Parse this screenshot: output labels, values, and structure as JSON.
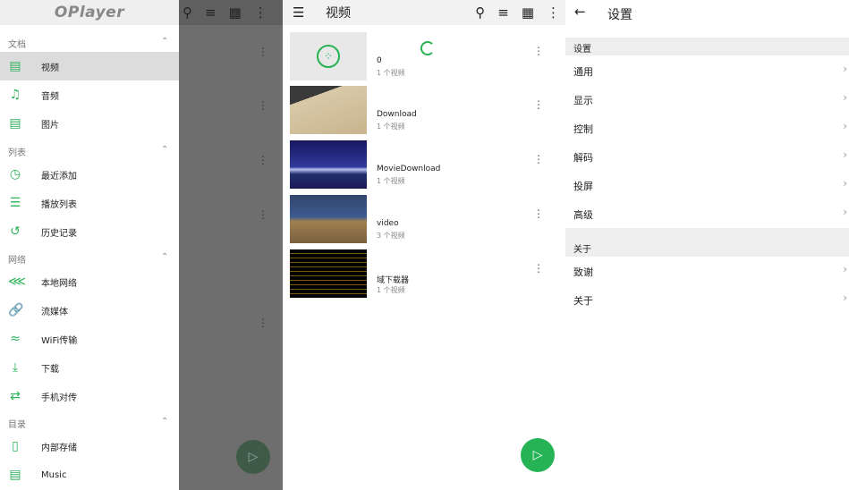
{
  "drawer": {
    "logo": "OPlayer",
    "sections": [
      {
        "title": "文档",
        "items": [
          "视频",
          "音频",
          "图片"
        ]
      },
      {
        "title": "列表",
        "items": [
          "最近添加",
          "播放列表",
          "历史记录"
        ]
      },
      {
        "title": "网络",
        "items": [
          "本地网络",
          "流媒体",
          "WiFi传输",
          "下载",
          "手机对传"
        ]
      },
      {
        "title": "目录",
        "items": [
          "内部存储",
          "Music"
        ]
      }
    ],
    "selected": "视频"
  },
  "video_screen": {
    "title": "视频",
    "folders": [
      {
        "name": "0",
        "count": "1 个视频"
      },
      {
        "name": "Download",
        "count": "1 个视频"
      },
      {
        "name": "MovieDownload",
        "count": "1 个视频"
      },
      {
        "name": "video",
        "count": "3 个视频"
      },
      {
        "name": "域下载器",
        "count": "1 个视频"
      }
    ]
  },
  "settings": {
    "title": "设置",
    "section1": "设置",
    "items1": [
      "通用",
      "显示",
      "控制",
      "解码",
      "投屏",
      "高级"
    ],
    "section2": "关于",
    "items2": [
      "致谢",
      "关于"
    ]
  },
  "colors": {
    "accent": "#25b356"
  }
}
